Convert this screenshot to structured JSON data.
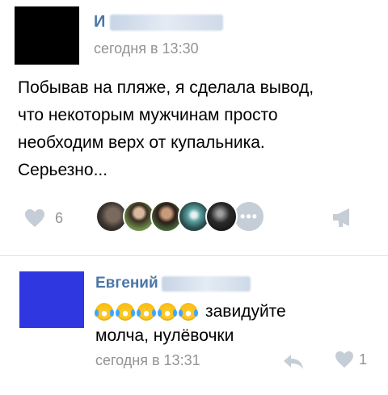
{
  "post": {
    "author_visible": "И",
    "time": "сегодня в 13:30",
    "text": "Побывав на пляже, я сделала вывод,\nчто некоторым мужчинам просто\nнеобходим верх от купальника.\nСерьезно...",
    "likes_count": "6",
    "more_label": "•••"
  },
  "comment": {
    "author_visible": "Евгений",
    "text_emojis": [
      "face-with-tears-of-joy",
      "face-with-tears-of-joy",
      "face-with-tears-of-joy",
      "face-with-tears-of-joy",
      "face-with-tears-of-joy"
    ],
    "text_line1": "завидуйте",
    "text_line2": "молча, нулёвочки",
    "time": "сегодня в 13:31",
    "likes_count": "1"
  },
  "colors": {
    "link": "#4a76a8",
    "meta": "#939393",
    "icon": "#c5cdd7",
    "comment_avatar": "#2f38e0"
  },
  "icons": {
    "like": "heart-icon",
    "share": "megaphone-icon",
    "reply": "reply-arrow-icon"
  }
}
